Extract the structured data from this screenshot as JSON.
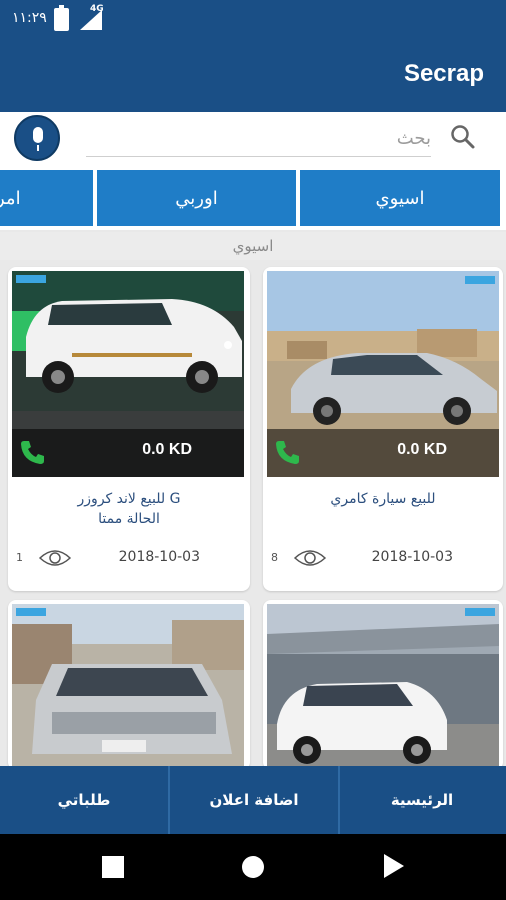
{
  "status_bar": {
    "time": "١١:٢٩",
    "network": "4G"
  },
  "app": {
    "title": "Secrap"
  },
  "search": {
    "placeholder": "بحث"
  },
  "categories": [
    {
      "label": "اسيوي"
    },
    {
      "label": "اوربي"
    },
    {
      "label": "امر"
    }
  ],
  "current_category": "اسيوي",
  "cards": [
    {
      "title_line1": "للبيع سيارة كامري",
      "title_line2": "",
      "price": "0.0 KD",
      "date": "2018-10-03",
      "views": "8"
    },
    {
      "title_line1": "للبيع لاند كروزر G",
      "title_line2": "الحالة ممتا",
      "price": "0.0 KD",
      "date": "2018-10-03",
      "views": "1"
    },
    {
      "title_line1": "",
      "title_line2": "",
      "price": "",
      "date": "",
      "views": ""
    },
    {
      "title_line1": "",
      "title_line2": "",
      "price": "",
      "date": "",
      "views": ""
    }
  ],
  "bottom_nav": [
    {
      "label": "الرئيسية"
    },
    {
      "label": "اضافة اعلان"
    },
    {
      "label": "طلباتي"
    }
  ],
  "colors": {
    "primary": "#1a4f86",
    "accent": "#1f7dc7",
    "call": "#2eb84c"
  }
}
